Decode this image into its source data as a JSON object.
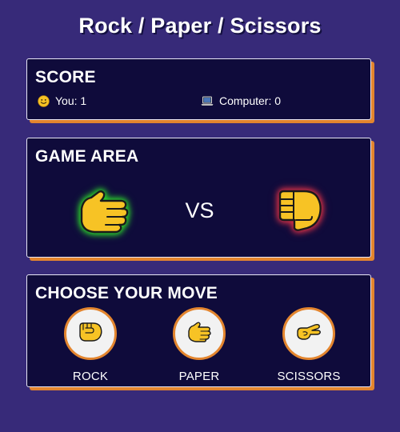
{
  "title": "Rock / Paper / Scissors",
  "score": {
    "heading": "SCORE",
    "you_label": "You: 1",
    "you_icon": "smiley-face-icon",
    "computer_label": "Computer: 0",
    "computer_icon": "laptop-icon"
  },
  "game": {
    "heading": "GAME AREA",
    "vs": "VS",
    "player_hand_icon": "hand-paper-icon",
    "computer_hand_icon": "hand-fist-icon"
  },
  "moves": {
    "heading": "CHOOSE YOUR MOVE",
    "items": [
      {
        "label": "ROCK",
        "icon": "fist-icon"
      },
      {
        "label": "PAPER",
        "icon": "open-hand-icon"
      },
      {
        "label": "SCISSORS",
        "icon": "scissors-hand-icon"
      }
    ]
  },
  "colors": {
    "background": "#372a79",
    "panel": "#0f0b3b",
    "accent": "#e3852e",
    "win_glow": "#2bd12b",
    "lose_glow": "#d32f45",
    "hand_yellow": "#f7c325"
  }
}
